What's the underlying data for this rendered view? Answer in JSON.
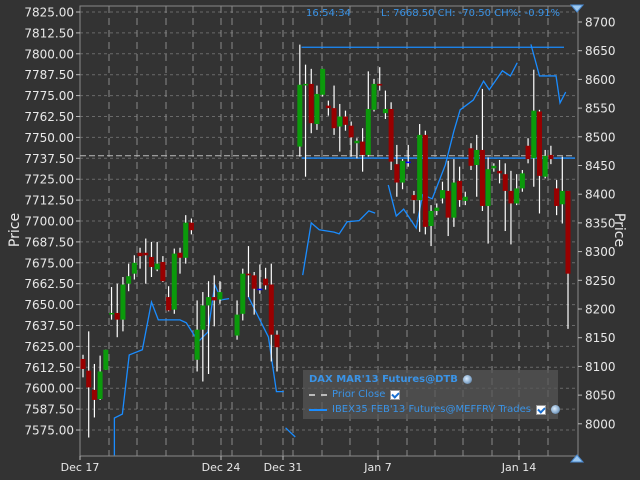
{
  "header": {
    "time": "16:54:34",
    "quote": "L: 7668.50 CH: -70.50 CH%: -0.91%"
  },
  "legend": {
    "title": "DAX MAR'13 Futures@DTB",
    "items": [
      {
        "label": "Prior Close",
        "checked": true,
        "style": "dashed",
        "color": "#bbbbbb"
      },
      {
        "label": "IBEX35 FEB'13 Futures@MEFFRV Trades",
        "checked": true,
        "style": "solid",
        "color": "#1a8cff"
      }
    ]
  },
  "chart_data": {
    "type": "candlestick",
    "left_axis": {
      "title": "Price",
      "range": [
        7575,
        7825
      ],
      "ticks": [
        "7825.00",
        "7812.50",
        "7800.00",
        "7787.50",
        "7775.00",
        "7762.50",
        "7750.00",
        "7737.50",
        "7725.00",
        "7712.50",
        "7700.00",
        "7687.50",
        "7675.00",
        "7662.50",
        "7650.00",
        "7637.50",
        "7625.00",
        "7612.50",
        "7600.00",
        "7587.50",
        "7575.00"
      ]
    },
    "right_axis": {
      "title": "Price",
      "range": [
        8000,
        8700
      ],
      "ticks": [
        "8700",
        "8650",
        "8600",
        "8550",
        "8500",
        "8450",
        "8400",
        "8350",
        "8300",
        "8250",
        "8200",
        "8150",
        "8100",
        "8050",
        "8000"
      ]
    },
    "x_axis": {
      "tick_labels": [
        "Dec 17",
        "Dec 24",
        "Dec 31",
        "Jan 7",
        "Jan 14"
      ]
    },
    "grid": true,
    "colors": {
      "up": "#0b9a0b",
      "down": "#990000",
      "unchanged": "#0000ff",
      "ibex": "#1a8cff",
      "prior_close": "#bbbbbb",
      "background": "#333333"
    },
    "candle_fields": [
      "open",
      "high",
      "low",
      "close"
    ],
    "candles": [
      [
        7617.5,
        7620,
        7606.5,
        7611.5
      ],
      [
        7610.5,
        7634,
        7570.5,
        7600.5
      ],
      [
        7599,
        7614.5,
        7582.5,
        7593
      ],
      [
        7593.5,
        7619.5,
        7593,
        7610
      ],
      [
        7611,
        7623,
        7611,
        7623
      ],
      [
        7644.5,
        7660.5,
        7641,
        7645
      ],
      [
        7645,
        7662.5,
        7630.5,
        7641
      ],
      [
        7641,
        7666.5,
        7634,
        7662
      ],
      [
        7662.5,
        7674.5,
        7658,
        7667
      ],
      [
        7668.5,
        7679.5,
        7665,
        7675
      ],
      [
        7681,
        7684,
        7671.5,
        7679
      ],
      [
        7681,
        7689.5,
        7662.5,
        7679.5
      ],
      [
        7678.5,
        7687.5,
        7666.5,
        7672.5
      ],
      [
        7671,
        7687.5,
        7670,
        7674.5
      ],
      [
        7675.5,
        7679,
        7663.5,
        7664
      ],
      [
        7654.5,
        7661,
        7646,
        7646.5
      ],
      [
        7647,
        7683.5,
        7644.5,
        7680.5
      ],
      [
        7681,
        7684,
        7668.5,
        7678
      ],
      [
        7678,
        7703.5,
        7674.5,
        7699
      ],
      [
        7699,
        7701.5,
        7692,
        7694.5
      ],
      [
        7617,
        7652.5,
        7610,
        7635
      ],
      [
        7635,
        7657.5,
        7604,
        7649.5
      ],
      [
        7649.5,
        7664,
        7608.5,
        7654.5
      ],
      [
        7654.5,
        7667.5,
        7637,
        7652.5
      ],
      [
        7653,
        7664,
        7650.5,
        7657.5
      ],
      null,
      null,
      [
        7631.5,
        7652.5,
        7629,
        7644
      ],
      [
        7644.5,
        7671.5,
        7640.5,
        7668.5
      ],
      [
        7668.5,
        7685,
        7654.5,
        7667.5
      ],
      [
        7667.5,
        7669.5,
        7644,
        7659.5
      ],
      [
        7659.5,
        7674,
        7656.5,
        7659.5
      ],
      [
        7665.5,
        7672,
        7659,
        7661.5
      ],
      [
        7662,
        7674.5,
        7616,
        7632
      ],
      [
        7632,
        7634.5,
        7610,
        7624.5
      ],
      null,
      null,
      null,
      [
        7744.5,
        7805.5,
        7738.5,
        7781.5
      ],
      [
        7781.5,
        7793.5,
        7726.5,
        7782
      ],
      [
        7782,
        7791,
        7752.5,
        7758.5
      ],
      [
        7758,
        7781,
        7754.5,
        7776
      ],
      [
        7775.5,
        7791,
        7774.5,
        7791
      ],
      [
        7769,
        7772,
        7763,
        7767.5
      ],
      [
        7767.5,
        7781,
        7751.5,
        7755.5
      ],
      [
        7756.5,
        7770,
        7741.5,
        7762.5
      ],
      [
        7762.5,
        7766,
        7754,
        7757.5
      ],
      [
        7757,
        7759.5,
        7738.5,
        7750
      ],
      [
        7746.5,
        7749.5,
        7737.5,
        7748
      ],
      [
        7747.5,
        7755.5,
        7729.5,
        7739.5
      ],
      [
        7739.5,
        7789.5,
        7738.5,
        7767
      ],
      [
        7766.5,
        7785,
        7765.5,
        7782
      ],
      [
        7782,
        7792,
        7778,
        7781
      ],
      [
        7764.5,
        7778,
        7761,
        7767
      ],
      [
        7767,
        7771,
        7730.5,
        7735.5
      ],
      [
        7734,
        7745.5,
        7714.5,
        7723
      ],
      [
        7723,
        7737,
        7719,
        7736
      ],
      [
        7735.5,
        7745.5,
        7732.5,
        7735.5
      ],
      [
        7715.5,
        7718,
        7704.5,
        7712.5
      ],
      [
        7712.5,
        7758,
        7693.5,
        7751.5
      ],
      [
        7751.5,
        7754,
        7692,
        7696.5
      ],
      [
        7697,
        7709.5,
        7685,
        7706
      ],
      [
        7706,
        7710.5,
        7703.5,
        7708
      ],
      [
        7713.5,
        7723.5,
        7710.5,
        7718.5
      ],
      [
        7718,
        7736,
        7691,
        7702
      ],
      [
        7702,
        7737,
        7696.5,
        7723
      ],
      [
        7724,
        7732.5,
        7708.5,
        7712.5
      ],
      [
        7712,
        7717.5,
        7709.5,
        7714.5
      ],
      [
        7743.5,
        7746.5,
        7730.5,
        7733
      ],
      [
        7733.5,
        7751.5,
        7714.5,
        7742.5
      ],
      [
        7742.5,
        7779,
        7706,
        7709
      ],
      [
        7709,
        7738,
        7686.5,
        7731
      ],
      [
        7731.5,
        7734.5,
        7729.5,
        7733
      ],
      [
        7730,
        7736.5,
        7722.5,
        7728.5
      ],
      [
        7728,
        7734.5,
        7694,
        7718
      ],
      [
        7718,
        7730,
        7686,
        7710.5
      ],
      [
        7710.5,
        7728,
        7709.5,
        7719.5
      ],
      [
        7719.5,
        7730.5,
        7717.5,
        7728.5
      ],
      [
        7745,
        7749.5,
        7734.5,
        7737
      ],
      [
        7737.5,
        7790.5,
        7720.5,
        7766
      ],
      [
        7765.5,
        7766.5,
        7704.5,
        7727
      ],
      [
        7726.5,
        7742.5,
        7725.5,
        7739
      ],
      [
        7739.5,
        7745,
        7734,
        7737
      ],
      [
        7719.5,
        7724.5,
        7703.5,
        7709
      ],
      [
        7710,
        7738.5,
        7698.5,
        7718
      ],
      [
        7718,
        7718,
        7635.5,
        7668.5
      ]
    ],
    "prior_close": 7739,
    "ibex_series": {
      "name": "IBEX35 FEB'13 Futures@MEFFRV Trades",
      "axis": "right",
      "segments": [
        [
          [
            5.5,
            7945
          ],
          [
            5.5,
            8010
          ],
          [
            6.9,
            8017
          ],
          [
            8.1,
            8120
          ],
          [
            10.4,
            8129
          ],
          [
            12.0,
            8212
          ],
          [
            13.2,
            8181
          ],
          [
            17.0,
            8181
          ],
          [
            18.1,
            8176
          ],
          [
            20.2,
            8143
          ],
          [
            21.9,
            8160
          ],
          [
            23.1,
            8242
          ],
          [
            24.3,
            8216
          ],
          [
            25.6,
            8218
          ]
        ],
        [
          [
            29.0,
            8221
          ],
          [
            32.5,
            8151
          ],
          [
            33.9,
            8056
          ],
          [
            35.2,
            8056
          ]
        ],
        [
          [
            35.5,
            7993
          ],
          [
            37.2,
            7977
          ]
        ],
        [
          [
            38.5,
            8259
          ],
          [
            40.0,
            8350
          ],
          [
            41.4,
            8338
          ],
          [
            44.0,
            8334
          ],
          [
            44.9,
            8331
          ],
          [
            46.3,
            8352
          ],
          [
            48.4,
            8354
          ],
          [
            50.1,
            8371
          ],
          [
            51.2,
            8367
          ]
        ],
        [
          [
            53.5,
            8416
          ],
          [
            54.9,
            8362
          ],
          [
            56.2,
            8374
          ],
          [
            58.4,
            8341
          ],
          [
            59.5,
            8399
          ],
          [
            61.2,
            8392
          ],
          [
            63.5,
            8451
          ],
          [
            65.0,
            8510
          ],
          [
            66.1,
            8547
          ],
          [
            68.4,
            8564
          ],
          [
            70.2,
            8597
          ],
          [
            71.2,
            8582
          ],
          [
            73.5,
            8615
          ],
          [
            74.9,
            8606
          ],
          [
            76.1,
            8629
          ]
        ],
        [
          [
            78.5,
            8661
          ],
          [
            80.0,
            8606
          ],
          [
            82.9,
            8606
          ],
          [
            83.6,
            8559
          ],
          [
            84.6,
            8578
          ]
        ]
      ],
      "range_lines": [
        {
          "value": 8656,
          "from": 38.3,
          "to": 84.3
        },
        {
          "value": 8463,
          "from": 38.3,
          "to": 86.3
        }
      ]
    }
  }
}
